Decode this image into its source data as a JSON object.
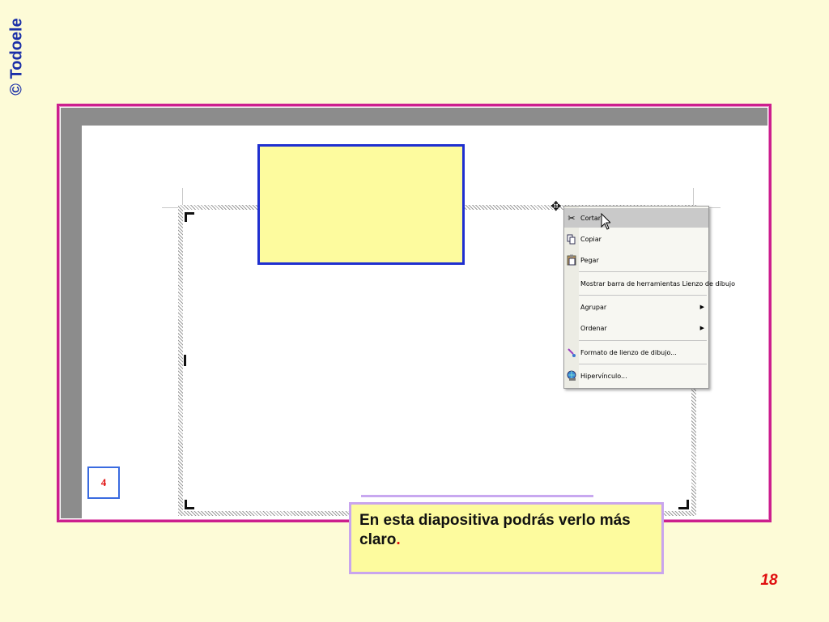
{
  "watermark": "© Todoele",
  "context_menu": {
    "items": [
      {
        "label": "Cortar",
        "icon": "scissors-icon",
        "highlighted": true
      },
      {
        "label": "Copiar",
        "icon": "copy-icon"
      },
      {
        "label": "Pegar",
        "icon": "paste-icon"
      },
      {
        "label": "Mostrar barra de herramientas Lienzo de dibujo",
        "icon": ""
      },
      {
        "label": "Agrupar",
        "icon": "",
        "submenu": true
      },
      {
        "label": "Ordenar",
        "icon": "",
        "submenu": true
      },
      {
        "label": "Formato de lienzo de dibujo...",
        "icon": "format-brush-icon"
      },
      {
        "label": "Hipervínculo...",
        "icon": "hyperlink-globe-icon"
      }
    ]
  },
  "slide_box_number": "4",
  "callout": {
    "text": "En esta diapositiva podrás verlo más claro",
    "period": "."
  },
  "page_number": "18",
  "colors": {
    "background": "#fdfbd7",
    "frame_border": "#cc1f8e",
    "yellow_fill": "#fdfb9e",
    "rect_border": "#1f2fd0",
    "accent_red": "#e01010",
    "callout_border": "#c9a5ee"
  }
}
